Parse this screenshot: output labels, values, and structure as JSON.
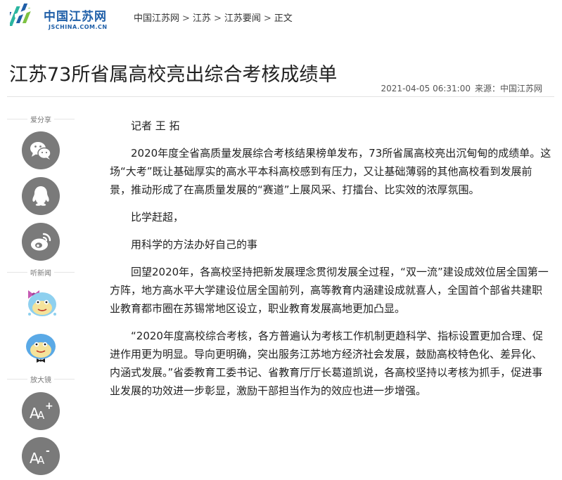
{
  "site": {
    "name": "中国江苏网",
    "domain": "JSCHINA.COM.CN"
  },
  "breadcrumb": [
    "中国江苏网",
    "江苏",
    "江苏要闻",
    "正文"
  ],
  "article": {
    "title": "江苏73所省属高校亮出综合考核成绩单",
    "datetime": "2021-04-05 06:31:00",
    "source": "来源：中国江苏网",
    "paragraphs": [
      "记者 王 拓",
      "2020年度全省高质量发展综合考核结果榜单发布，73所省属高校亮出沉甸甸的成绩单。这场“大考”既让基础厚实的高水平本科高校感到有压力，又让基础薄弱的其他高校看到发展前景，推动形成了在高质量发展的“赛道”上展风采、打擂台、比实效的浓厚氛围。",
      "比学赶超，",
      "用科学的方法办好自己的事",
      "回望2020年，各高校坚持把新发展理念贯彻发展全过程，“双一流”建设成效位居全国第一方阵，地方高水平大学建设位居全国前列，高等教育内涵建设成就喜人，全国首个部省共建职业教育都市圈在苏锡常地区设立，职业教育发展高地更加凸显。",
      "“2020年度高校综合考核，各方普遍认为考核工作机制更趋科学、指标设置更加合理、促进作用更为明显。导向更明确，突出服务江苏地方经济社会发展，鼓励高校特色化、差异化、内涵式发展。”省委教育工委书记、省教育厅厅长葛道凯说，各高校坚持以考核为抓手，促进事业发展的功效进一步彰显，激励干部担当作为的效应也进一步增强。"
    ]
  },
  "sidebar": {
    "share_label": "爱分享",
    "listen_label": "听新闻",
    "zoom_label": "放大镜",
    "share_icons": [
      "wechat-icon",
      "qq-icon",
      "weibo-icon"
    ],
    "listen_icons": [
      "female-voice-avatar",
      "male-voice-avatar"
    ],
    "zoom_icons": [
      "font-increase-icon",
      "font-decrease-icon"
    ]
  },
  "colors": {
    "brand": "#1f5fa8",
    "logo_green": "#5cb85c",
    "icon_gray": "#7a7a7a"
  }
}
